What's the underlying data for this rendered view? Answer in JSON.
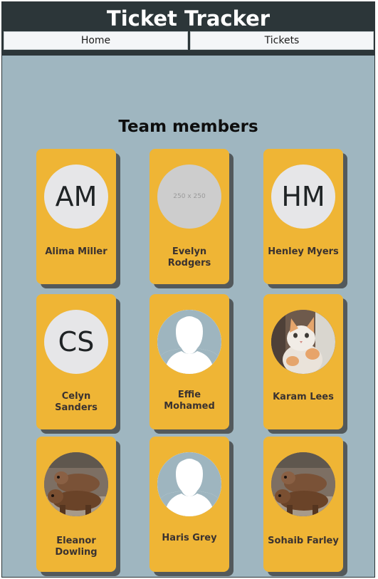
{
  "app": {
    "title": "Ticket Tracker"
  },
  "nav": {
    "home": "Home",
    "tickets": "Tickets"
  },
  "page": {
    "section_title": "Team members"
  },
  "members": [
    {
      "name": "Alima Miller",
      "avatar_type": "initials",
      "avatar_text": "AM"
    },
    {
      "name": "Evelyn Rodgers",
      "avatar_type": "placeholder",
      "avatar_text": "250 x 250"
    },
    {
      "name": "Henley Myers",
      "avatar_type": "initials",
      "avatar_text": "HM"
    },
    {
      "name": "Celyn Sanders",
      "avatar_type": "initials",
      "avatar_text": "CS"
    },
    {
      "name": "Effie Mohamed",
      "avatar_type": "silhouette-icon"
    },
    {
      "name": "Karam Lees",
      "avatar_type": "kitten-photo"
    },
    {
      "name": "Eleanor Dowling",
      "avatar_type": "bear-photo"
    },
    {
      "name": "Haris Grey",
      "avatar_type": "silhouette-icon"
    },
    {
      "name": "Sohaib Farley",
      "avatar_type": "bear-photo"
    }
  ],
  "colors": {
    "page_background": "#9fb6c0",
    "header_background": "#2c3639",
    "card_background": "#efb535",
    "card_shadow": "#53595b",
    "avatar_background": "#e6e6e8"
  }
}
